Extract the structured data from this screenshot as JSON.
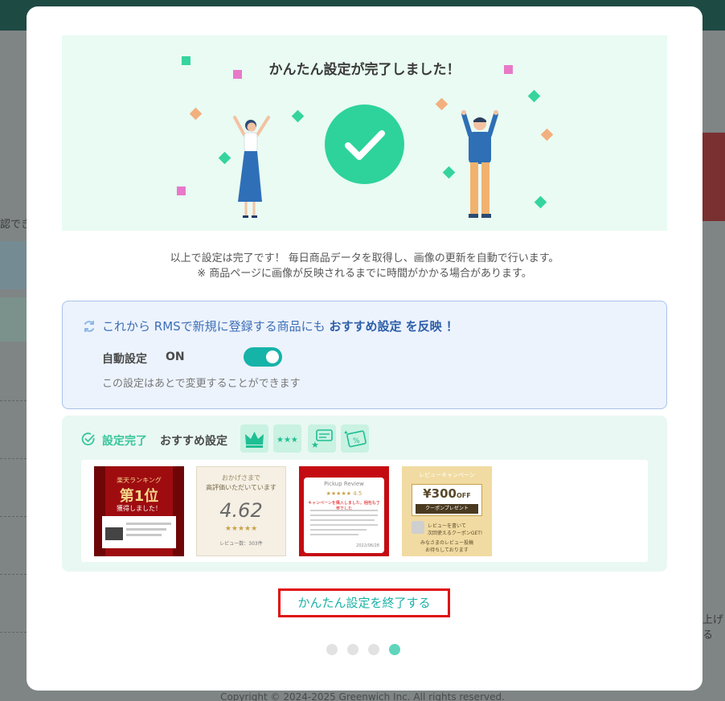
{
  "background": {
    "left_text": "認でき",
    "right_text": "上げる",
    "copyright": "Copyright © 2024-2025 Greenwich Inc. All rights reserved."
  },
  "modal": {
    "hero_title": "かんたん設定が完了しました！",
    "description_line1": "以上で設定は完了です！ 毎日商品データを取得し、画像の更新を自動で行います。",
    "description_line2": "※ 商品ページに画像が反映されるまでに時間がかかる場合があります。",
    "rms": {
      "text_prefix": "これから RMSで新規に登録する商品にも",
      "text_strong": "おすすめ設定 を反映 ！",
      "auto_label": "自動設定",
      "auto_value": "ON",
      "toggle_on": true,
      "note": "この設定はあとで変更することができます"
    },
    "done": {
      "done_label": "設定完了",
      "recommend_label": "おすすめ設定",
      "badges": [
        "crown-icon",
        "stars-icon",
        "review-bubble-icon",
        "coupon-icon"
      ],
      "thumbnails": [
        {
          "name": "ranking",
          "line1": "楽天ランキング",
          "line2": "第1位",
          "line3": "獲得しました！"
        },
        {
          "name": "rating",
          "line1": "おかげさまで",
          "line2": "高評価いただいています",
          "line3": "4.62",
          "line4": "レビュー数：303件"
        },
        {
          "name": "pickup-review",
          "line1": "Pickup Review",
          "line2": "4.5",
          "line3": "キャンペーンを購入しました。梱包も丁寧でした",
          "line4": "2022/06/28"
        },
        {
          "name": "review-campaign",
          "line1": "レビューキャンペーン",
          "line2": "¥300",
          "line3": "OFF",
          "line4": "クーポンプレゼント",
          "line5": "レビューを書いて",
          "line6": "次回使えるクーポンGET!",
          "line7": "みなさまのレビュー投稿",
          "line8": "お待ちしております"
        }
      ]
    },
    "finish_button": "かんたん設定を終了する",
    "pagination": {
      "total": 4,
      "active_index": 3
    },
    "colors": {
      "accent": "#1bb2a6",
      "success": "#2dd39b",
      "highlight_border": "#e01010",
      "info_blue": "#3d6fb6"
    }
  }
}
